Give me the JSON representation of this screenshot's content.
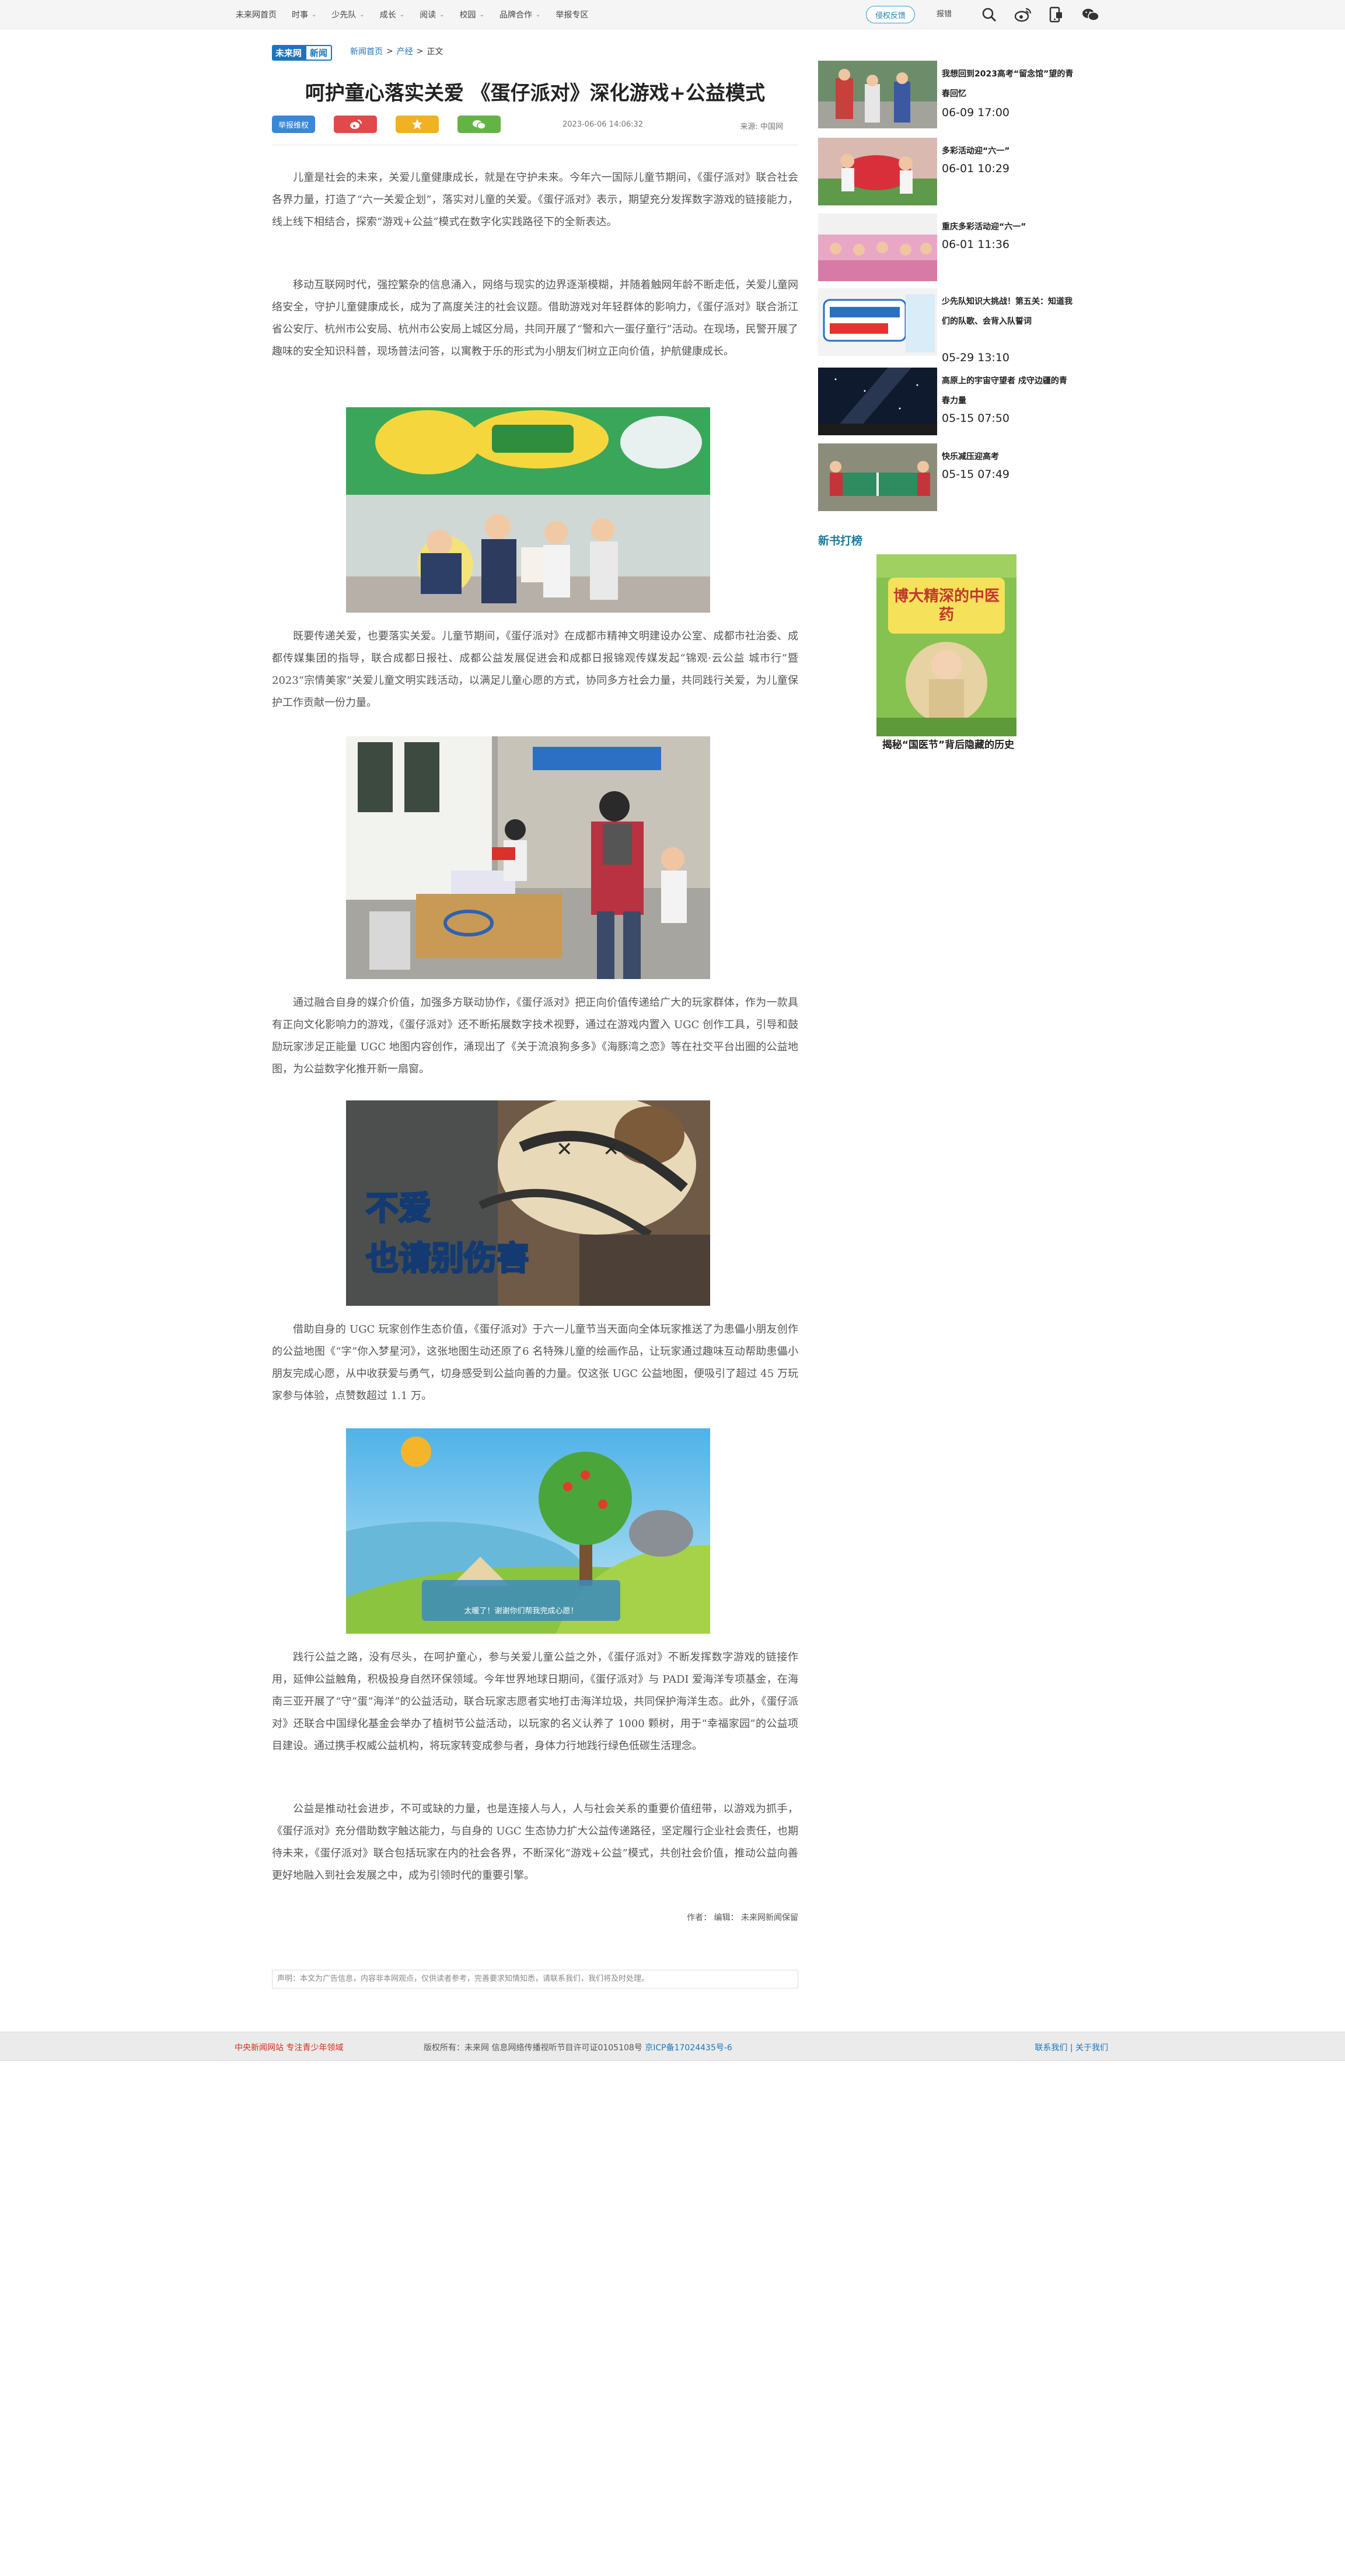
{
  "topbar": {
    "nav": [
      {
        "label": "未来网首页",
        "has_menu": false
      },
      {
        "label": "时事",
        "has_menu": true
      },
      {
        "label": "少先队",
        "has_menu": true
      },
      {
        "label": "成长",
        "has_menu": true
      },
      {
        "label": "阅读",
        "has_menu": true
      },
      {
        "label": "校园",
        "has_menu": true
      },
      {
        "label": "品牌合作",
        "has_menu": true
      },
      {
        "label": "举报专区",
        "has_menu": false
      }
    ],
    "feedback_label": "侵权反馈",
    "report_label": "报错",
    "icons": [
      "search-icon",
      "weibo-icon",
      "mobile-icon",
      "wechat-icon"
    ]
  },
  "logo": {
    "part1": "未来网",
    "part2": "新闻"
  },
  "breadcrumb": {
    "home": "新闻首页",
    "sep": ">",
    "section": "产经",
    "current": "正文"
  },
  "article": {
    "title": "呵护童心落实关爱 《蛋仔派对》深化游戏+公益模式",
    "rights_button": "举报维权",
    "share_icons": [
      "weibo-icon",
      "qzone-icon",
      "wechat-icon"
    ],
    "time": "2023-06-06 14:06:32",
    "source": "来源: 中国网",
    "paragraphs": [
      "儿童是社会的未来，关爱儿童健康成长，就是在守护未来。今年六一国际儿童节期间，《蛋仔派对》联合社会各界力量，打造了“六一关爱企划”，落实对儿童的关爱。《蛋仔派对》表示，期望充分发挥数字游戏的链接能力，线上线下相结合，探索“游戏+公益”模式在数字化实践路径下的全新表达。",
      "移动互联网时代，强控繁杂的信息涌入，网络与现实的边界逐渐模糊，并随着触网年龄不断走低，关爱儿童网络安全，守护儿童健康成长，成为了高度关注的社会议题。借助游戏对年轻群体的影响力，《蛋仔派对》联合浙江省公安厅、杭州市公安局、杭州市公安局上城区分局，共同开展了“警和六一蛋仔童行”活动。在现场，民警开展了趣味的安全知识科普，现场普法问答，以寓教于乐的形式为小朋友们树立正向价值，护航健康成长。",
      "既要传递关爱，也要落实关爱。儿童节期间，《蛋仔派对》在成都市精神文明建设办公室、成都市社治委、成都传媒集团的指导，联合成都日报社、成都公益发展促进会和成都日报锦观传媒发起“锦观·云公益 城市行”暨2023“宗情美家”关爱儿童文明实践活动，以满足儿童心愿的方式，协同多方社会力量，共同践行关爱，为儿童保护工作贡献一份力量。",
      "通过融合自身的媒介价值，加强多方联动协作，《蛋仔派对》把正向价值传递给广大的玩家群体，作为一款具有正向文化影响力的游戏，《蛋仔派对》还不断拓展数字技术视野，通过在游戏内置入 UGC 创作工具，引导和鼓励玩家涉足正能量 UGC 地图内容创作，涌现出了《关于流浪狗多多》《海豚湾之恋》等在社交平台出圈的公益地图，为公益数字化推开新一扇窗。",
      "借助自身的 UGC 玩家创作生态价值，《蛋仔派对》于六一儿童节当天面向全体玩家推送了为患儡小朋友创作的公益地图《“字”你入梦星河》，这张地图生动还原了6 名特殊儿童的绘画作品，让玩家通过趣味互动帮助患儡小朋友完成心愿，从中收获爱与勇气，切身感受到公益向善的力量。仅这张 UGC 公益地图，便吸引了超过 45 万玩家参与体验，点赞数超过 1.1 万。",
      "践行公益之路，没有尽头，在呵护童心，参与关爱儿童公益之外，《蛋仔派对》不断发挥数字游戏的链接作用，延伸公益触角，积极投身自然环保领域。今年世界地球日期间，《蛋仔派对》与 PADI 爱海洋专项基金，在海南三亚开展了“守“蛋”海洋”的公益活动，联合玩家志愿者实地打击海洋垃圾，共同保护海洋生态。此外，《蛋仔派对》还联合中国绿化基金会举办了植树节公益活动，以玩家的名义认养了 1000 颗树，用于“幸福家园”的公益项目建设。通过携手权威公益机构，将玩家转变成参与者，身体力行地践行绿色低碳生活理念。",
      "公益是推动社会进步，不可或缺的力量，也是连接人与人，人与社会关系的重要价值纽带，以游戏为抓手，《蛋仔派对》充分借助数字触达能力，与自身的 UGC  生态协力扩大公益传递路径，坚定履行企业社会责任，也期待未来，《蛋仔派对》联合包括玩家在内的社会各界，不断深化“游戏+公益”模式，共创社会价值，推动公益向善更好地融入到社会发展之中，成为引领时代的重要引擎。"
    ],
    "photo_texts": {
      "photo3_line1": "不爱",
      "photo3_line2": "也请别伤害",
      "photo4_caption": "太暖了！谢谢你们帮我完成心愿！"
    },
    "author_line": "作者：  编辑：  未来网新闻保留",
    "disclaimer": "声明：本文为广告信息，内容非本网观点，仅供读者参考，完善要求知情知悉，请联系我们，我们将及时处理。"
  },
  "sidebar": {
    "items": [
      {
        "title": "我想回到2023高考“留念馆”望的青春回忆",
        "date": "06-09 17:00"
      },
      {
        "title": "多彩活动迎“六一”",
        "date": "06-01 10:29"
      },
      {
        "title": "重庆多彩活动迎“六一”",
        "date": "06-01 11:36"
      },
      {
        "title": "少先队知识大挑战！第五关：知道我们的队歌、会背入队誓词",
        "date": "05-29 13:10"
      },
      {
        "title": "高原上的宇宙守望者 戍守边疆的青春力量",
        "date": "05-15 07:50"
      },
      {
        "title": "快乐减压迎高考",
        "date": "05-15 07:49"
      }
    ],
    "newbook_heading": "新书打榜",
    "book_cover_title": "博大精深的中医药",
    "book_caption": "揭秘“国医节”背后隐藏的历史"
  },
  "footer": {
    "left": "中央新闻网站  专注青少年领域",
    "middle_prefix": "版权所有：未来网 信息网络传播视听节目许可证0105108号 ",
    "icp": "京ICP备17024435号-6",
    "right": "联系我们 | 关于我们"
  },
  "colors": {
    "accent_blue": "#1c75bc",
    "footer_red": "#d52b1e",
    "teal_heading": "#1c7a98"
  }
}
